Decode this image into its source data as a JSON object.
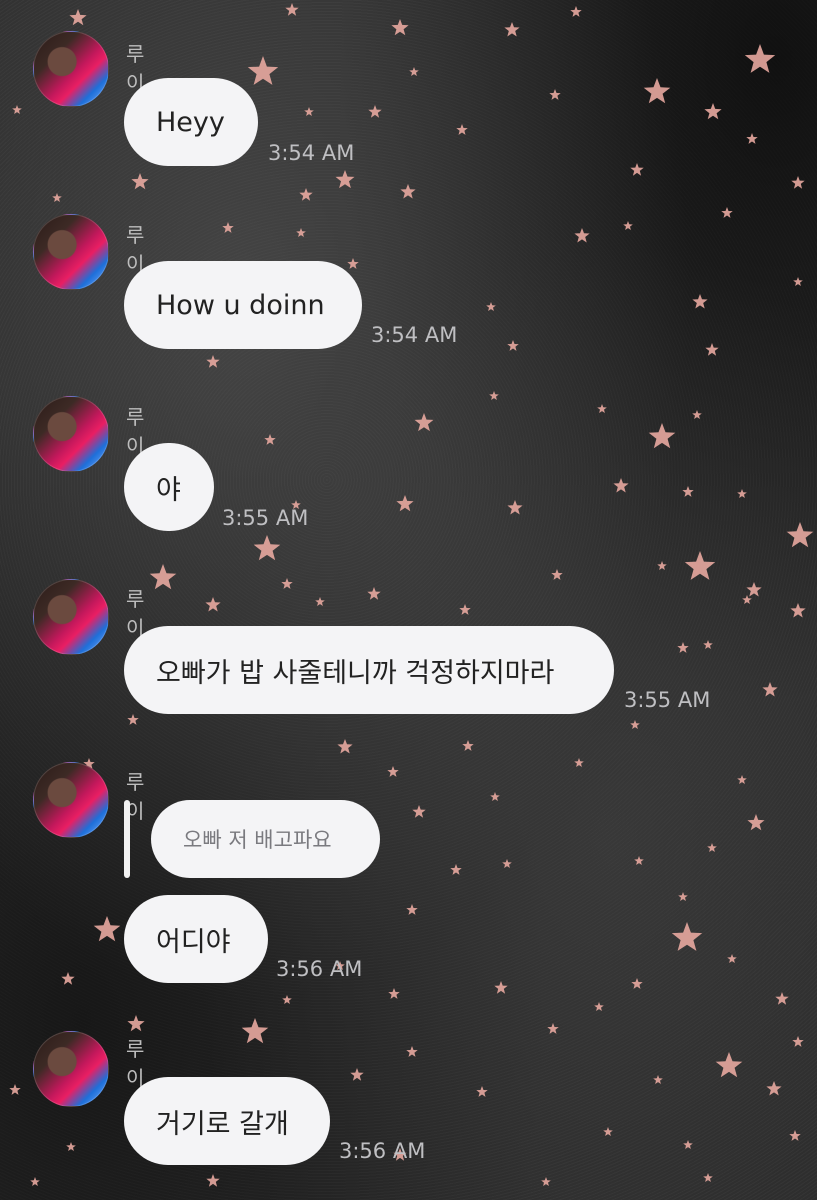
{
  "colors": {
    "bubble": "#f4f4f6",
    "star": "#e8a9a0",
    "background": "#2a2a2a",
    "timestamp": "#bfbfc2"
  },
  "messages": [
    {
      "sender": "루이",
      "text": "Heyy",
      "time": "3:54 AM"
    },
    {
      "sender": "루이",
      "text": "How u doinn",
      "time": "3:54 AM"
    },
    {
      "sender": "루이",
      "text": "야",
      "time": "3:55 AM"
    },
    {
      "sender": "루이",
      "text": "오빠가 밥 사줄테니까 걱정하지마라",
      "time": "3:55 AM"
    },
    {
      "sender": "루이",
      "reply_to": "오빠 저 배고파요",
      "text": "어디야",
      "time": "3:56 AM"
    },
    {
      "sender": "루이",
      "text": "거기로 갈개",
      "time": "3:56 AM"
    }
  ]
}
